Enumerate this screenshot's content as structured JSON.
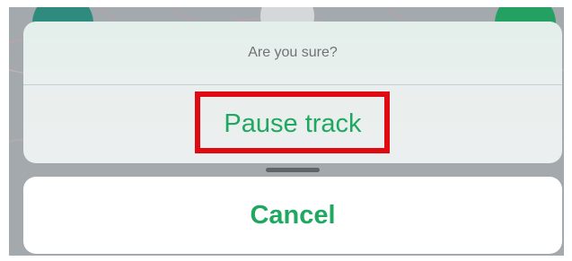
{
  "action_sheet": {
    "title": "Are you sure?",
    "primary_action_label": "Pause track"
  },
  "cancel_label": "Cancel",
  "colors": {
    "accent_green": "#1fa85f",
    "highlight_red": "#e00a12",
    "sheet_background": "#e9efee",
    "title_gray": "#6f7274"
  }
}
